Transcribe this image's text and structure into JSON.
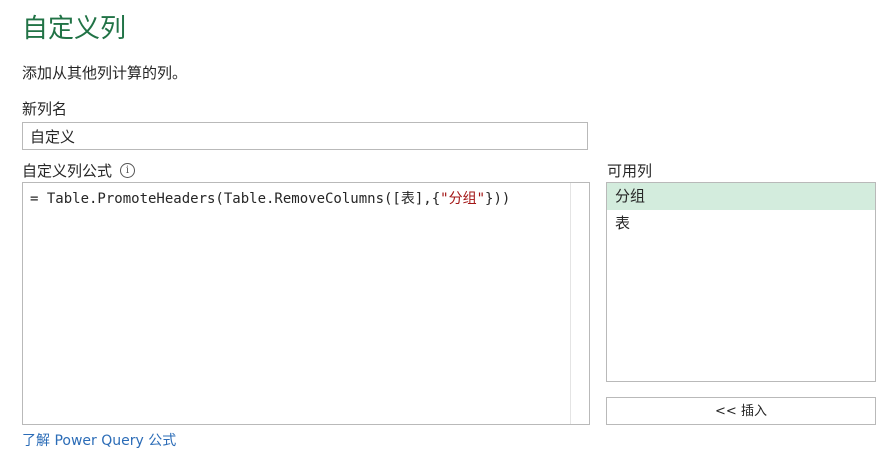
{
  "dialog": {
    "title": "自定义列",
    "subtitle": "添加从其他列计算的列。",
    "new_column_label": "新列名",
    "new_column_value": "自定义",
    "formula_label": "自定义列公式",
    "info_icon_glyph": "i",
    "formula_prefix": "= Table.PromoteHeaders(Table.RemoveColumns([表],{",
    "formula_string": "\"分组\"",
    "formula_suffix": "}))",
    "available_label": "可用列",
    "available_columns": [
      "分组",
      "表"
    ],
    "selected_column": "分组",
    "insert_button": "<< 插入",
    "learn_link": "了解 Power Query 公式"
  },
  "colors": {
    "accent": "#217346",
    "selection": "#d3ecdd",
    "link": "#2b6cb7",
    "string_literal": "#a31515"
  }
}
